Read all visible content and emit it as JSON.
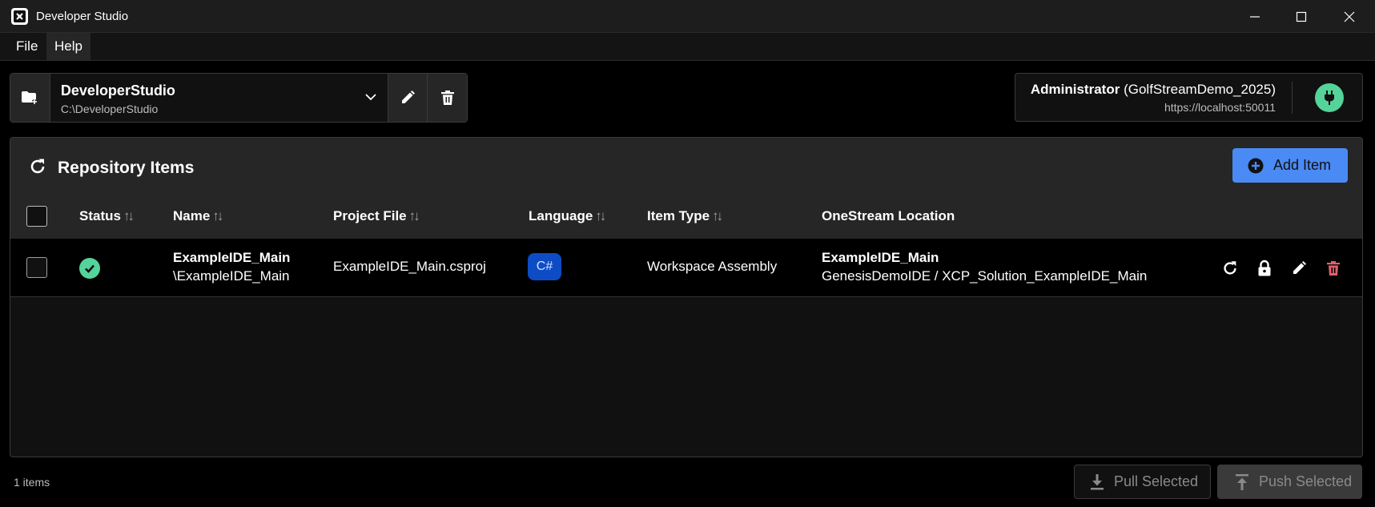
{
  "window": {
    "title": "Developer Studio"
  },
  "menu": {
    "file": "File",
    "help": "Help"
  },
  "project": {
    "name": "DeveloperStudio",
    "path": "C:\\DeveloperStudio"
  },
  "connection": {
    "user": "Administrator",
    "environment": "(GolfStreamDemo_2025)",
    "url": "https://localhost:50011",
    "status_color": "#54d39a"
  },
  "repository": {
    "title": "Repository Items",
    "add_label": "Add Item",
    "columns": {
      "status": "Status",
      "name": "Name",
      "project_file": "Project File",
      "language": "Language",
      "item_type": "Item Type",
      "location": "OneStream Location"
    },
    "sort_glyph": "↑↓",
    "items": [
      {
        "status": "ok",
        "name": "ExampleIDE_Main",
        "subpath": "\\ExampleIDE_Main",
        "project_file": "ExampleIDE_Main.csproj",
        "language": "C#",
        "item_type": "Workspace Assembly",
        "location_title": "ExampleIDE_Main",
        "location_path": "GenesisDemoIDE / XCP_Solution_ExampleIDE_Main"
      }
    ]
  },
  "footer": {
    "count": "1 items",
    "pull_label": "Pull Selected",
    "push_label": "Push Selected"
  },
  "colors": {
    "accent": "#4a8af4",
    "success": "#54d39a",
    "danger": "#e0606c",
    "badge": "#0d4cc4"
  }
}
